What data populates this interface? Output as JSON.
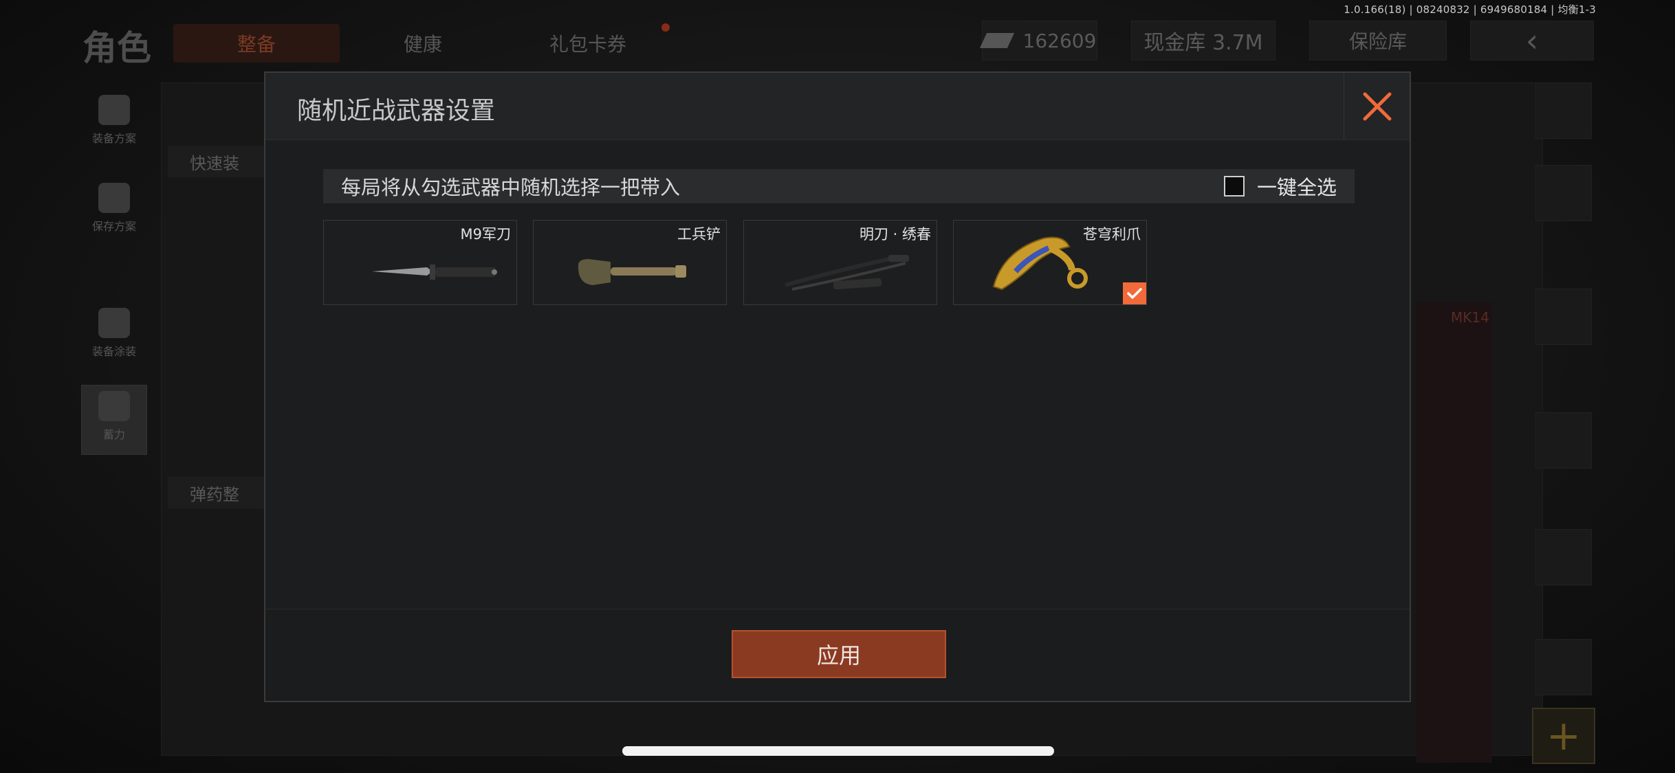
{
  "status_bar": {
    "version_text": "1.0.166(18) | 08240832 | 6949680184 | 均衡1-3"
  },
  "background": {
    "title": "角色",
    "tabs": [
      {
        "label": "整备",
        "active": true
      },
      {
        "label": "健康",
        "active": false
      },
      {
        "label": "礼包卡券",
        "active": false
      }
    ],
    "currency_value": "162609",
    "vault_label": "现金库 3.7M",
    "safe_label": "保险库",
    "back_icon": "chevron-left-icon",
    "sidebar": [
      {
        "label": "装备方案",
        "icon": "vest-icon"
      },
      {
        "label": "保存方案",
        "icon": "download-icon"
      },
      {
        "label": "装备涂装",
        "icon": "helmet-icon"
      },
      {
        "label": "蓄力",
        "icon": "bolt-hex-icon"
      }
    ],
    "quick_label": "快速装",
    "ammo_label": "弹药整",
    "weapon_tag": "MK14"
  },
  "modal": {
    "title": "随机近战武器设置",
    "close_icon": "close-icon",
    "info_text": "每局将从勾选武器中随机选择一把带入",
    "select_all_label": "一键全选",
    "select_all_checked": false,
    "weapons": [
      {
        "name": "M9军刀",
        "icon": "combat-knife-icon",
        "checked": false
      },
      {
        "name": "工兵铲",
        "icon": "shovel-icon",
        "checked": false
      },
      {
        "name": "明刀 · 绣春",
        "icon": "saber-icon",
        "checked": false
      },
      {
        "name": "苍穹利爪",
        "icon": "karambit-icon",
        "checked": true
      }
    ],
    "apply_label": "应用"
  },
  "colors": {
    "accent": "#f06a3a",
    "apply_bg": "#8b3a22",
    "modal_bg": "#1c1d1e"
  }
}
